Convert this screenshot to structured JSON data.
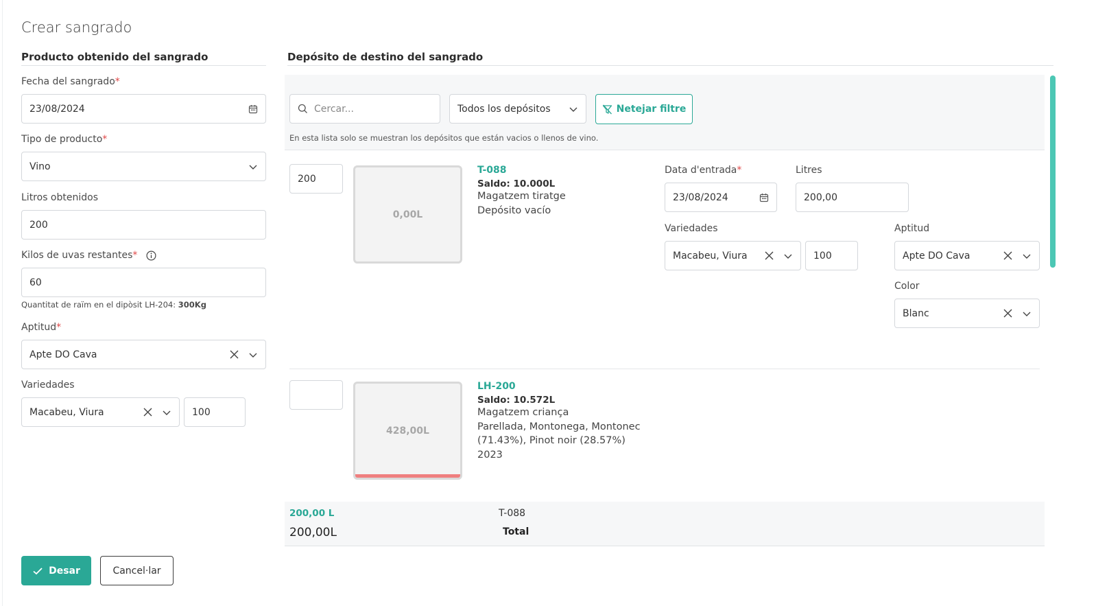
{
  "page": {
    "title": "Crear sangrado"
  },
  "left": {
    "section_title": "Producto obtenido del sangrado",
    "fecha": {
      "label": "Fecha del sangrado",
      "required": "*",
      "value": "23/08/2024"
    },
    "tipo": {
      "label": "Tipo de producto",
      "required": "*",
      "value": "Vino"
    },
    "litros": {
      "label": "Litros obtenidos",
      "value": "200"
    },
    "kilos": {
      "label": "Kilos de uvas restantes",
      "required": "*",
      "value": "60",
      "note_prefix": "Quantitat de raïm en el dipòsit LH-204: ",
      "note_value": "300Kg"
    },
    "aptitud": {
      "label": "Aptitud",
      "required": "*",
      "value": "Apte DO Cava"
    },
    "variedades": {
      "label": "Variedades",
      "value": "Macabeu, Viura",
      "percent": "100"
    }
  },
  "right": {
    "section_title": "Depósito de destino del sangrado",
    "search_placeholder": "Cercar...",
    "filter_select": "Todos los depósitos",
    "clear_filter": "Netejar filtre",
    "hint": "En esta lista solo se muestran los depósitos que están vacios o llenos de vino.",
    "deposits": [
      {
        "qty": "200",
        "tank_label": "0,00L",
        "fill_fraction": 0,
        "code": "T-088",
        "saldo": "Saldo: 10.000L",
        "lines": [
          "Magatzem tiratge",
          "Depósito vacío"
        ],
        "form": {
          "data_label": "Data d'entrada",
          "data_required": "*",
          "data_value": "23/08/2024",
          "litres_label": "Litres",
          "litres_value": "200,00",
          "varietats_label": "Variedades",
          "varietats_value": "Macabeu, Viura",
          "varietats_percent": "100",
          "aptitud_label": "Aptitud",
          "aptitud_value": "Apte DO Cava",
          "color_label": "Color",
          "color_value": "Blanc"
        }
      },
      {
        "qty": "",
        "tank_label": "428,00L",
        "fill_fraction": 0.04,
        "code": "LH-200",
        "saldo": "Saldo: 10.572L",
        "lines": [
          "Magatzem criança",
          "Parellada, Montonega, Montonec",
          "(71.43%), Pinot noir (28.57%)",
          "2023"
        ]
      }
    ],
    "summary": {
      "amount": "200,00 L",
      "deposit": "T-088",
      "total_amount": "200,00L",
      "total_label": "Total"
    }
  },
  "actions": {
    "save": "Desar",
    "cancel": "Cancel·lar"
  },
  "colors": {
    "accent": "#2aa896",
    "required": "#e04848",
    "tank_fill": "#ef7f7f"
  }
}
